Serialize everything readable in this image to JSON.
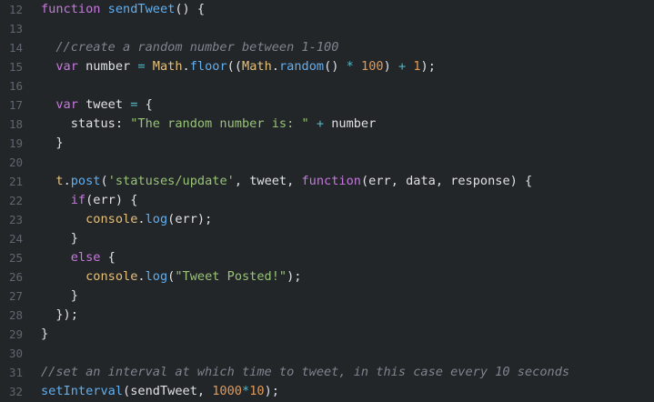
{
  "editor": {
    "colors": {
      "background": "#232629",
      "line_number": "#5f6670",
      "keyword": "#c678dd",
      "function": "#61afef",
      "object": "#e5c07b",
      "string": "#98c379",
      "number": "#e09956",
      "operator": "#56b6c2",
      "comment": "#7f848e",
      "plain": "#dfe1e6"
    },
    "lines": [
      {
        "number": "12",
        "tokens": [
          {
            "t": "kw",
            "v": "function"
          },
          {
            "t": "pl",
            "v": " "
          },
          {
            "t": "fn",
            "v": "sendTweet"
          },
          {
            "t": "pl",
            "v": "() {"
          }
        ]
      },
      {
        "number": "13",
        "tokens": []
      },
      {
        "number": "14",
        "tokens": [
          {
            "t": "pl",
            "v": "  "
          },
          {
            "t": "cm",
            "v": "//create a random number between 1-100"
          }
        ]
      },
      {
        "number": "15",
        "tokens": [
          {
            "t": "pl",
            "v": "  "
          },
          {
            "t": "kw",
            "v": "var"
          },
          {
            "t": "pl",
            "v": " number "
          },
          {
            "t": "op",
            "v": "="
          },
          {
            "t": "pl",
            "v": " "
          },
          {
            "t": "obj",
            "v": "Math"
          },
          {
            "t": "pl",
            "v": "."
          },
          {
            "t": "fn",
            "v": "floor"
          },
          {
            "t": "pl",
            "v": "(("
          },
          {
            "t": "obj",
            "v": "Math"
          },
          {
            "t": "pl",
            "v": "."
          },
          {
            "t": "fn",
            "v": "random"
          },
          {
            "t": "pl",
            "v": "() "
          },
          {
            "t": "op",
            "v": "*"
          },
          {
            "t": "pl",
            "v": " "
          },
          {
            "t": "num",
            "v": "100"
          },
          {
            "t": "pl",
            "v": ") "
          },
          {
            "t": "op",
            "v": "+"
          },
          {
            "t": "pl",
            "v": " "
          },
          {
            "t": "num",
            "v": "1"
          },
          {
            "t": "pl",
            "v": ");"
          }
        ]
      },
      {
        "number": "16",
        "tokens": []
      },
      {
        "number": "17",
        "tokens": [
          {
            "t": "pl",
            "v": "  "
          },
          {
            "t": "kw",
            "v": "var"
          },
          {
            "t": "pl",
            "v": " tweet "
          },
          {
            "t": "op",
            "v": "="
          },
          {
            "t": "pl",
            "v": " {"
          }
        ]
      },
      {
        "number": "18",
        "tokens": [
          {
            "t": "pl",
            "v": "    status: "
          },
          {
            "t": "str",
            "v": "\"The random number is: \""
          },
          {
            "t": "pl",
            "v": " "
          },
          {
            "t": "op",
            "v": "+"
          },
          {
            "t": "pl",
            "v": " number"
          }
        ]
      },
      {
        "number": "19",
        "tokens": [
          {
            "t": "pl",
            "v": "  }"
          }
        ]
      },
      {
        "number": "20",
        "tokens": []
      },
      {
        "number": "21",
        "tokens": [
          {
            "t": "pl",
            "v": "  "
          },
          {
            "t": "obj",
            "v": "t"
          },
          {
            "t": "pl",
            "v": "."
          },
          {
            "t": "fn",
            "v": "post"
          },
          {
            "t": "pl",
            "v": "("
          },
          {
            "t": "str",
            "v": "'statuses/update'"
          },
          {
            "t": "pl",
            "v": ", tweet, "
          },
          {
            "t": "kw",
            "v": "function"
          },
          {
            "t": "pl",
            "v": "(err, data, response) {"
          }
        ]
      },
      {
        "number": "22",
        "tokens": [
          {
            "t": "pl",
            "v": "    "
          },
          {
            "t": "kw",
            "v": "if"
          },
          {
            "t": "pl",
            "v": "(err) {"
          }
        ]
      },
      {
        "number": "23",
        "tokens": [
          {
            "t": "pl",
            "v": "      "
          },
          {
            "t": "obj",
            "v": "console"
          },
          {
            "t": "pl",
            "v": "."
          },
          {
            "t": "fn",
            "v": "log"
          },
          {
            "t": "pl",
            "v": "(err);"
          }
        ]
      },
      {
        "number": "24",
        "tokens": [
          {
            "t": "pl",
            "v": "    }"
          }
        ]
      },
      {
        "number": "25",
        "tokens": [
          {
            "t": "pl",
            "v": "    "
          },
          {
            "t": "kw",
            "v": "else"
          },
          {
            "t": "pl",
            "v": " {"
          }
        ]
      },
      {
        "number": "26",
        "tokens": [
          {
            "t": "pl",
            "v": "      "
          },
          {
            "t": "obj",
            "v": "console"
          },
          {
            "t": "pl",
            "v": "."
          },
          {
            "t": "fn",
            "v": "log"
          },
          {
            "t": "pl",
            "v": "("
          },
          {
            "t": "str",
            "v": "\"Tweet Posted!\""
          },
          {
            "t": "pl",
            "v": ");"
          }
        ]
      },
      {
        "number": "27",
        "tokens": [
          {
            "t": "pl",
            "v": "    }"
          }
        ]
      },
      {
        "number": "28",
        "tokens": [
          {
            "t": "pl",
            "v": "  });"
          }
        ]
      },
      {
        "number": "29",
        "tokens": [
          {
            "t": "pl",
            "v": "}"
          }
        ]
      },
      {
        "number": "30",
        "tokens": []
      },
      {
        "number": "31",
        "tokens": [
          {
            "t": "cm",
            "v": "//set an interval at which time to tweet, in this case every 10 seconds"
          }
        ]
      },
      {
        "number": "32",
        "tokens": [
          {
            "t": "fn",
            "v": "setInterval"
          },
          {
            "t": "pl",
            "v": "(sendTweet, "
          },
          {
            "t": "num",
            "v": "1000"
          },
          {
            "t": "op",
            "v": "*"
          },
          {
            "t": "num",
            "v": "10"
          },
          {
            "t": "pl",
            "v": ");"
          }
        ]
      }
    ]
  }
}
